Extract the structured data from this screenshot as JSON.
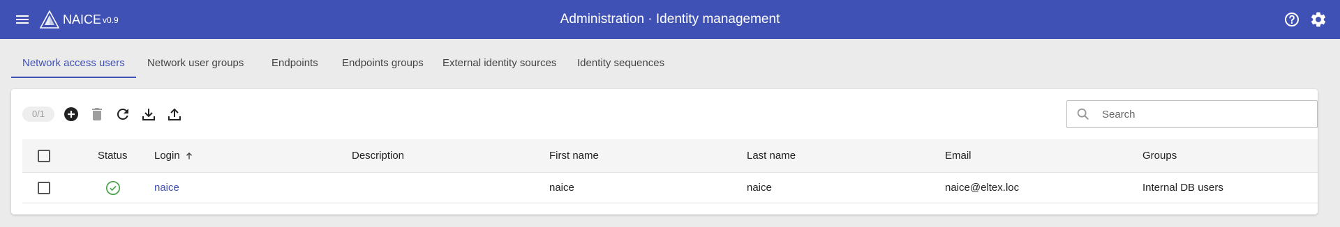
{
  "app": {
    "name": "NAICE",
    "version": "v0.9",
    "title": "Administration · Identity management"
  },
  "header_icons": {
    "menu": "menu-icon",
    "logo": "naice-logo",
    "help": "help-circle-icon",
    "settings": "gear-icon"
  },
  "tabs": [
    {
      "label": "Network access users",
      "active": true
    },
    {
      "label": "Network user groups",
      "active": false
    },
    {
      "label": "Endpoints",
      "active": false
    },
    {
      "label": "Endpoints groups",
      "active": false
    },
    {
      "label": "External identity sources",
      "active": false
    },
    {
      "label": "Identity sequences",
      "active": false
    }
  ],
  "toolbar": {
    "selection_counter": "0/1",
    "buttons": [
      "add-icon",
      "delete-icon",
      "refresh-icon",
      "download-icon",
      "upload-icon"
    ]
  },
  "search": {
    "placeholder": "Search",
    "value": ""
  },
  "table": {
    "columns": {
      "status": "Status",
      "login": "Login",
      "description": "Description",
      "first_name": "First name",
      "last_name": "Last name",
      "email": "Email",
      "groups": "Groups"
    },
    "sort": {
      "column": "login",
      "direction": "ascending"
    },
    "rows": [
      {
        "status": "active",
        "login": "naice",
        "description": "",
        "first_name": "naice",
        "last_name": "naice",
        "email": "naice@eltex.loc",
        "groups": "Internal DB users"
      }
    ]
  },
  "colors": {
    "primary": "#3f51b5",
    "status_ok": "#43a047",
    "background": "#ebebeb"
  }
}
